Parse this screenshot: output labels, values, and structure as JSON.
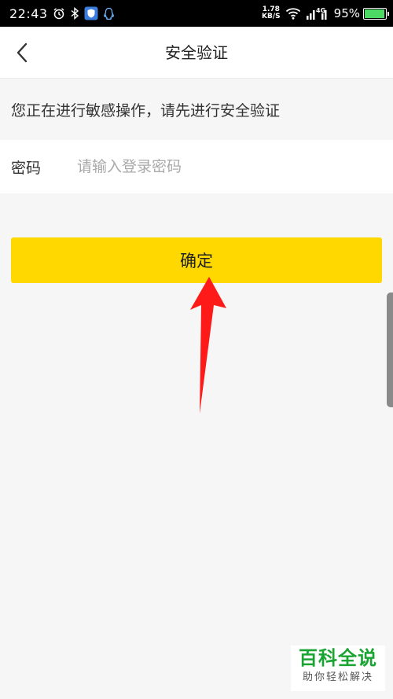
{
  "status_bar": {
    "time": "22:43",
    "net_speed_value": "1.78",
    "net_speed_unit": "KB/S",
    "network_type": "4G",
    "battery_level": 95,
    "battery_text": "95%",
    "icons": [
      "alarm-icon",
      "bluetooth-icon",
      "shield-app-icon",
      "qq-icon",
      "wifi-icon",
      "signal-icon",
      "battery-icon"
    ]
  },
  "nav": {
    "title": "安全验证"
  },
  "notice": {
    "text": "您正在进行敏感操作，请先进行安全验证"
  },
  "password": {
    "label": "密码",
    "placeholder": "请输入登录密码",
    "value": ""
  },
  "confirm": {
    "label": "确定"
  },
  "watermark": {
    "title": "百科全说",
    "subtitle": "助你轻松解决"
  },
  "colors": {
    "accent_yellow": "#ffd800",
    "page_bg": "#f6f6f6",
    "annotation_red": "#ff1a1a",
    "watermark_green": "#1aa533"
  }
}
